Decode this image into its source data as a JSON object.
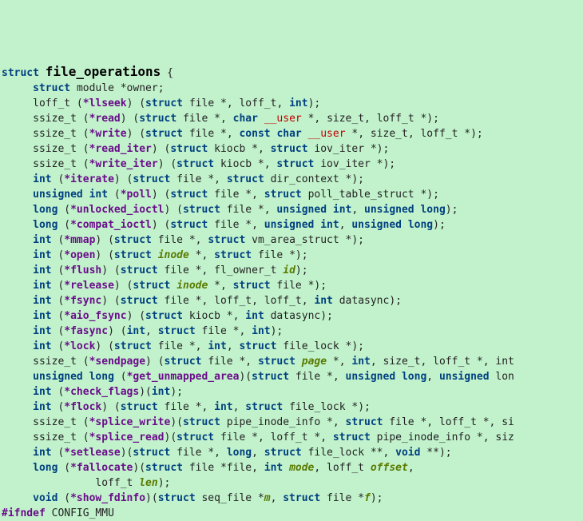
{
  "struct_name": "file_operations",
  "kw": {
    "struct": "struct",
    "module": "module",
    "loff_t": "loff_t",
    "ssize_t": "ssize_t",
    "int": "int",
    "unsigned": "unsigned",
    "long": "long",
    "void": "void",
    "const": "const",
    "char": "char",
    "size_t": "size_t"
  },
  "user": "__user",
  "owner": "*owner",
  "fn": {
    "llseek": "*llseek",
    "read": "*read",
    "write": "*write",
    "read_iter": "*read_iter",
    "write_iter": "*write_iter",
    "iterate": "*iterate",
    "poll": "*poll",
    "unlocked_ioctl": "*unlocked_ioctl",
    "compat_ioctl": "*compat_ioctl",
    "mmap": "*mmap",
    "open": "*open",
    "flush": "*flush",
    "release": "*release",
    "fsync": "*fsync",
    "aio_fsync": "*aio_fsync",
    "fasync": "*fasync",
    "lock": "*lock",
    "sendpage": "*sendpage",
    "get_unmapped_area": "*get_unmapped_area",
    "check_flags": "*check_flags",
    "flock": "*flock",
    "splice_write": "*splice_write",
    "splice_read": "*splice_read",
    "setlease": "*setlease",
    "fallocate": "*fallocate",
    "show_fdinfo": "*show_fdinfo"
  },
  "par": {
    "inode": "inode",
    "id": "id",
    "page": "page",
    "mode": "mode",
    "offset": "offset",
    "len": "len",
    "m": "m",
    "f": "f"
  },
  "txt": {
    "file_star": " file *",
    "kiocb_star": " kiocb *",
    "iov_iter_star": " iov_iter *",
    "dir_context_star": " dir_context *",
    "poll_table_struct_star": " poll_table_struct *",
    "vm_area_struct_star": " vm_area_struct *",
    "file_lock_star": " file_lock *",
    "pipe_inode_info_star": " pipe_inode_info *",
    "seq_file_star": " seq_file *",
    "file_lock_dstar": " file_lock **",
    "datasync": " datasync",
    "fl_owner_t": "fl_owner_t "
  },
  "pp": "#ifndef",
  "config": " CONFIG_MMU"
}
